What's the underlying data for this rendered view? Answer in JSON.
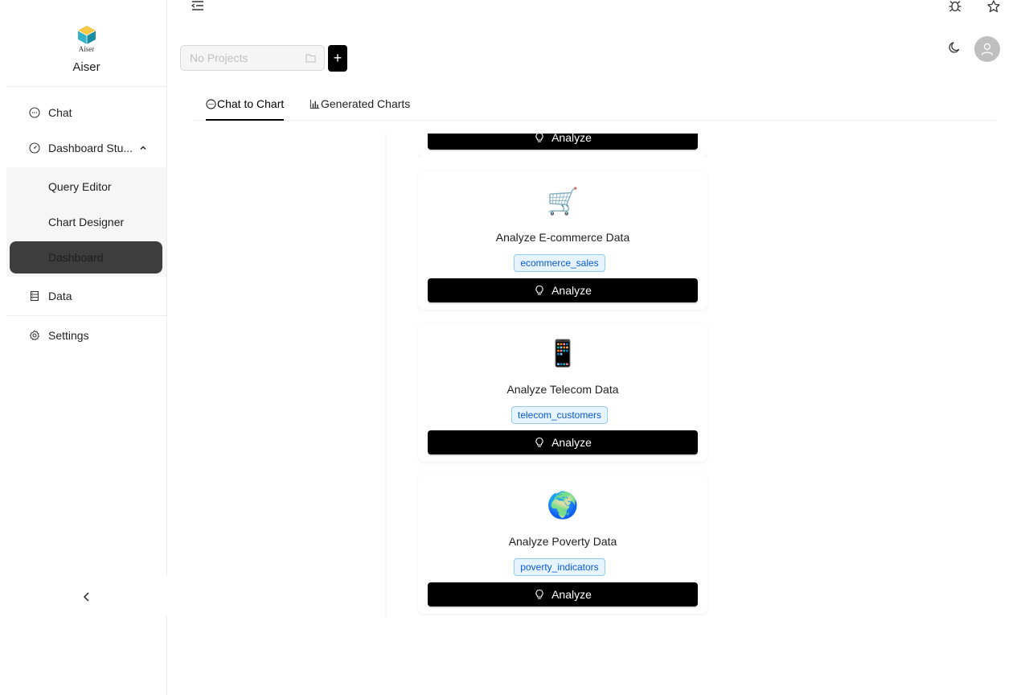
{
  "app": {
    "logo_text": "Aiser",
    "name": "Aiser"
  },
  "sidebar": {
    "items": [
      {
        "label": "Chat",
        "icon": "chat-bubble-icon"
      },
      {
        "label": "Dashboard Stu...",
        "icon": "dashboard-icon"
      },
      {
        "label": "Data",
        "icon": "database-icon"
      },
      {
        "label": "Settings",
        "icon": "gear-icon"
      }
    ],
    "subitems": [
      {
        "label": "Query Editor"
      },
      {
        "label": "Chart Designer"
      },
      {
        "label": "Dashboard",
        "active": true
      }
    ]
  },
  "header": {
    "project_placeholder": "No Projects",
    "add_label": "+"
  },
  "tabs": [
    {
      "label": "Chat to Chart",
      "active": true,
      "icon": "chat-bubble-icon"
    },
    {
      "label": "Generated Charts",
      "icon": "bar-chart-icon"
    }
  ],
  "cards": [
    {
      "emoji": "",
      "title": "",
      "tag": "",
      "button": "Analyze"
    },
    {
      "emoji": "🛒",
      "title": "Analyze E-commerce Data",
      "tag": "ecommerce_sales",
      "button": "Analyze"
    },
    {
      "emoji": "📱",
      "title": "Analyze Telecom Data",
      "tag": "telecom_customers",
      "button": "Analyze"
    },
    {
      "emoji": "🌍",
      "title": "Analyze Poverty Data",
      "tag": "poverty_indicators",
      "button": "Analyze"
    }
  ],
  "colors": {
    "primary": "#000000",
    "tag_bg": "#e6f4ff",
    "tag_border": "#91caff",
    "tag_text": "#0958d9",
    "active_nav": "#3d3d3d"
  }
}
